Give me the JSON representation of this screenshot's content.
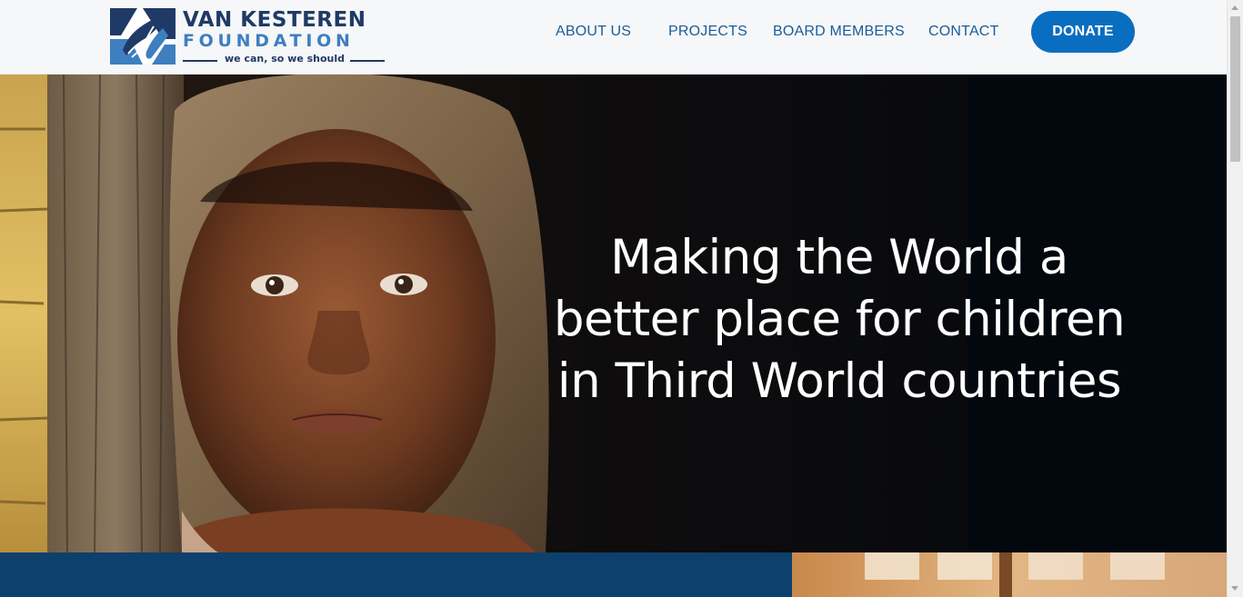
{
  "header": {
    "logo": {
      "line1": "VAN KESTEREN",
      "line2": "FOUNDATION",
      "tagline": "we can, so we should",
      "icon": "hands-logo-icon"
    },
    "nav": [
      {
        "label": "ABOUT US"
      },
      {
        "label": "PROJECTS"
      },
      {
        "label": "BOARD MEMBERS"
      },
      {
        "label": "CONTACT"
      }
    ],
    "donate_label": "DONATE"
  },
  "hero": {
    "heading_line1": "Making the World a",
    "heading_line2": "better place for children",
    "heading_line3": "in Third World countries",
    "photo": "child-portrait-photo"
  },
  "colors": {
    "brand_navy": "#1f3a66",
    "brand_blue": "#3e7fc0",
    "nav_text": "#1a5c9a",
    "donate_bg": "#0a6ec0",
    "band_blue": "#0d406d"
  }
}
